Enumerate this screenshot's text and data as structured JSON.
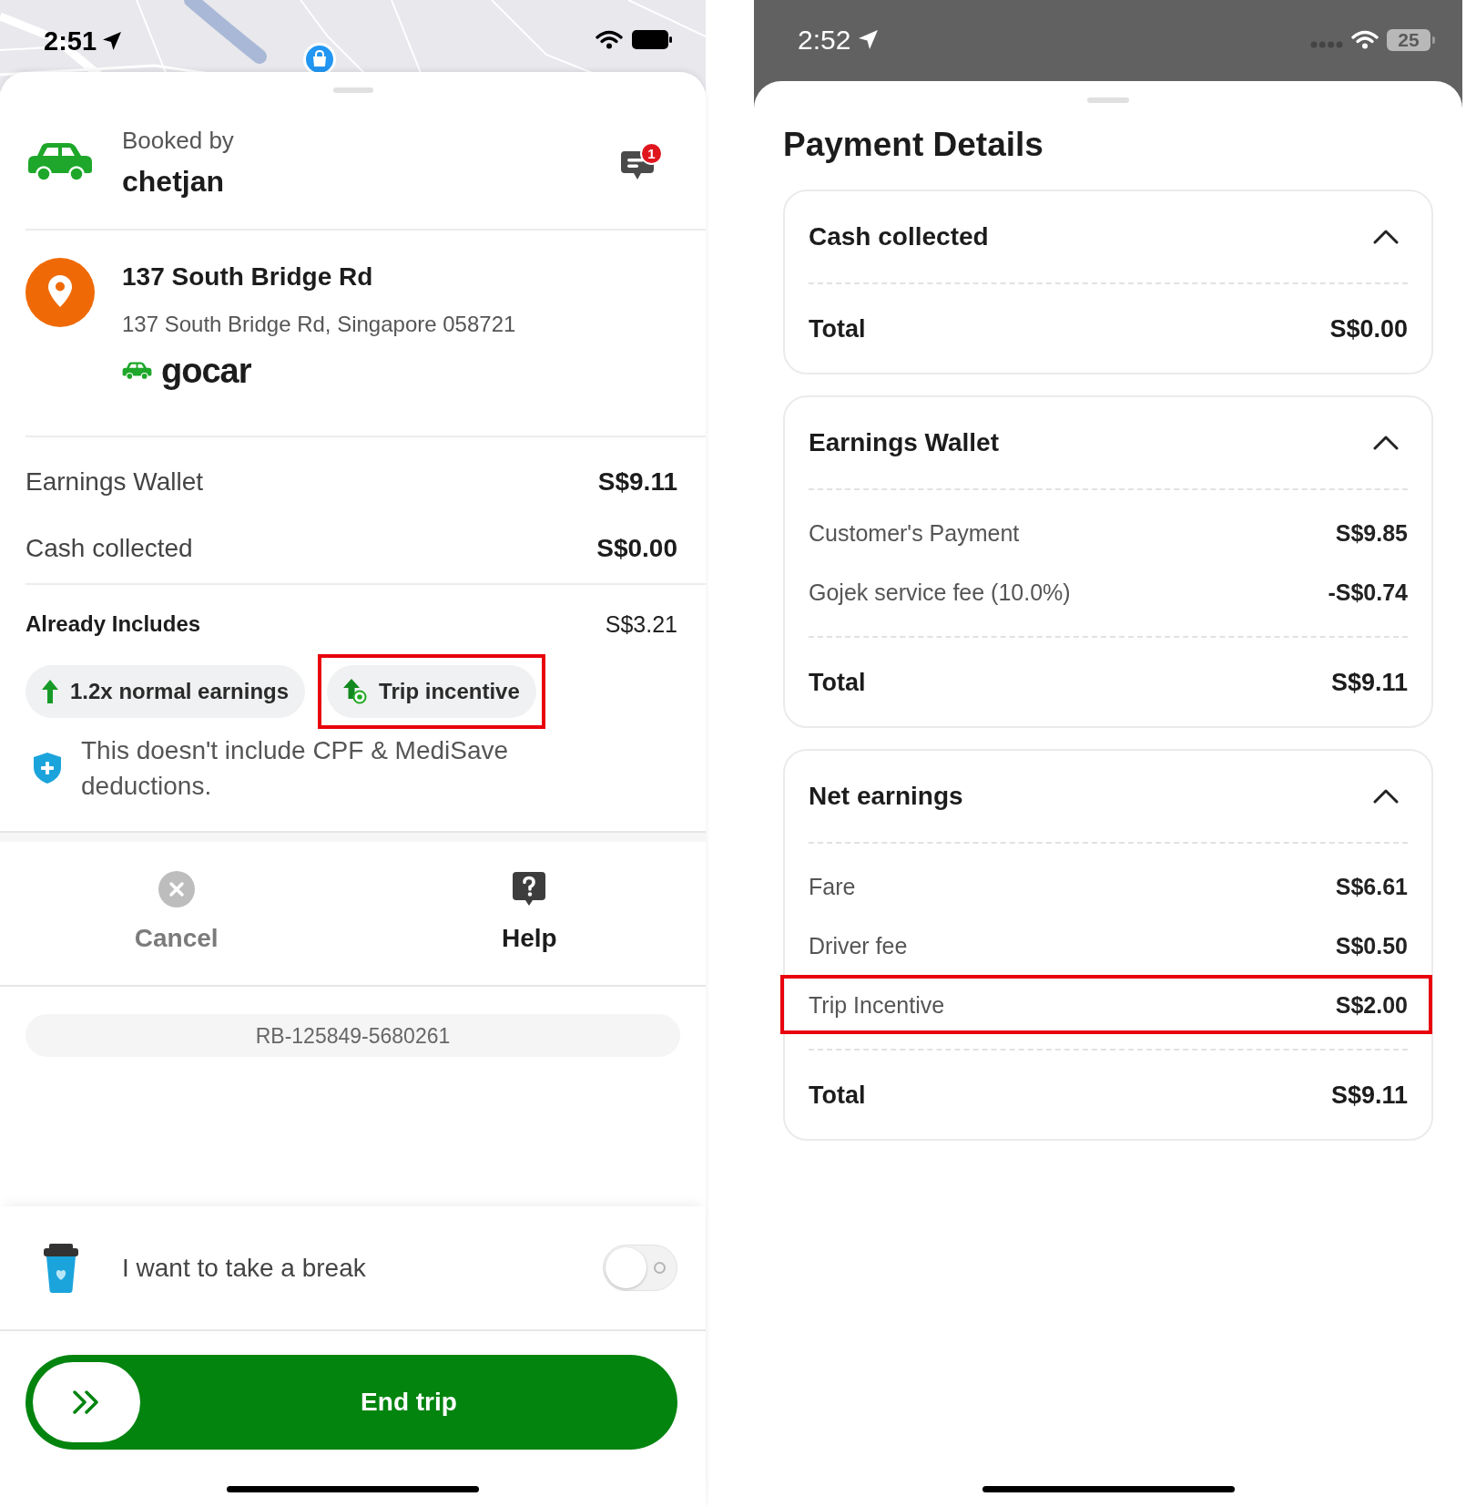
{
  "left_screen": {
    "status_bar": {
      "time": "2:51"
    },
    "booking": {
      "label": "Booked by",
      "customer": "chetjan",
      "unread_badge": "1"
    },
    "destination": {
      "name": "137 South Bridge Rd",
      "address": "137 South Bridge Rd, Singapore 058721",
      "service": "gocar"
    },
    "earnings": [
      {
        "label": "Earnings Wallet",
        "value": "S$9.11"
      },
      {
        "label": "Cash collected",
        "value": "S$0.00"
      }
    ],
    "includes": {
      "label": "Already Includes",
      "value": "S$3.21",
      "chips": [
        {
          "kind": "boost",
          "label": "1.2x normal earnings",
          "highlighted": false
        },
        {
          "kind": "incentive",
          "label": "Trip incentive",
          "highlighted": true
        }
      ]
    },
    "notice": "This doesn't include CPF & MediSave deductions.",
    "actions": [
      {
        "kind": "cancel",
        "label": "Cancel",
        "disabled": true
      },
      {
        "kind": "help",
        "label": "Help",
        "disabled": false
      }
    ],
    "booking_id": "RB-125849-5680261",
    "break_toggle": {
      "label": "I want to take a break",
      "on": false
    },
    "slide_button": {
      "label": "End trip"
    }
  },
  "right_screen": {
    "status_bar": {
      "time": "2:52",
      "battery": "25"
    },
    "title": "Payment Details",
    "sections": [
      {
        "title": "Cash collected",
        "expanded": true,
        "total": {
          "label": "Total",
          "value": "S$0.00"
        }
      },
      {
        "title": "Earnings Wallet",
        "expanded": true,
        "rows": [
          {
            "label": "Customer's Payment",
            "value": "S$9.85",
            "highlighted": false
          },
          {
            "label": "Gojek service fee (10.0%)",
            "value": "-S$0.74",
            "highlighted": false
          }
        ],
        "total": {
          "label": "Total",
          "value": "S$9.11"
        }
      },
      {
        "title": "Net earnings",
        "expanded": true,
        "rows": [
          {
            "label": "Fare",
            "value": "S$6.61",
            "highlighted": false
          },
          {
            "label": "Driver fee",
            "value": "S$0.50",
            "highlighted": false
          },
          {
            "label": "Trip Incentive",
            "value": "S$2.00",
            "highlighted": true
          }
        ],
        "total": {
          "label": "Total",
          "value": "S$9.11"
        }
      }
    ]
  }
}
